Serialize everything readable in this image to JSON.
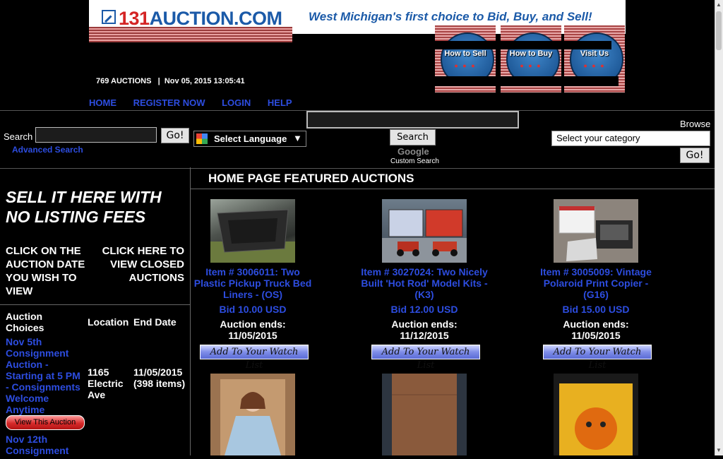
{
  "header": {
    "logo_number": "131",
    "logo_domain": "AUCTION.COM",
    "tagline": "West Michigan's first choice to Bid, Buy, and Sell!",
    "promos": [
      {
        "label": "How to Sell"
      },
      {
        "label": "How to Buy"
      },
      {
        "label": "Visit Us"
      }
    ],
    "auction_count": "769 AUCTIONS",
    "separator": "|",
    "datetime": "Nov 05, 2015 13:05:41"
  },
  "nav": {
    "home": "HOME",
    "register": "REGISTER NOW",
    "login": "LOGIN",
    "help": "HELP"
  },
  "search": {
    "label": "Search",
    "go_label": "Go!",
    "advanced_label": "Advanced Search",
    "language_label": "Select Language",
    "language_caret": "▼",
    "google_button": "Search",
    "google_logo": "Google",
    "custom_search": "Custom Search",
    "browse_label": "Browse",
    "category_placeholder": "Select your category",
    "browse_go": "Go!"
  },
  "sidebar": {
    "sell_heading": "SELL IT HERE WITH NO LISTING FEES",
    "click_date": "CLICK ON THE AUCTION DATE YOU WISH TO VIEW",
    "click_closed": "CLICK HERE TO VIEW CLOSED AUCTIONS",
    "col_choices": "Auction Choices",
    "col_location": "Location",
    "col_end": "End Date",
    "auctions": [
      {
        "name": "Nov 5th Consignment Auction - Starting at 5 PM - Consignments Welcome Anytime",
        "location": "1165 Electric Ave",
        "end": "11/05/2015 (398 items)",
        "view_label": "View This Auction"
      },
      {
        "name": "Nov 12th Consignment"
      }
    ]
  },
  "featured": {
    "title": "HOME PAGE FEATURED AUCTIONS",
    "watch_label": "Add To Your Watch List",
    "ends_label": "Auction ends:",
    "items": [
      {
        "title": "Item # 3006011: Two Plastic Pickup Truck Bed Liners - (OS)",
        "bid": "Bid 10.00 USD",
        "ends": "11/05/2015"
      },
      {
        "title": "Item # 3027024: Two Nicely Built 'Hot Rod' Model Kits - (K3)",
        "bid": "Bid 12.00 USD",
        "ends": "11/12/2015"
      },
      {
        "title": "Item # 3005009: Vintage Polaroid Print Copier - (G16)",
        "bid": "Bid 15.00 USD",
        "ends": "11/05/2015"
      }
    ]
  },
  "colors": {
    "link": "#2d4de0",
    "background": "#000000",
    "logo_red": "#d42424",
    "logo_blue": "#1b5aa8"
  }
}
